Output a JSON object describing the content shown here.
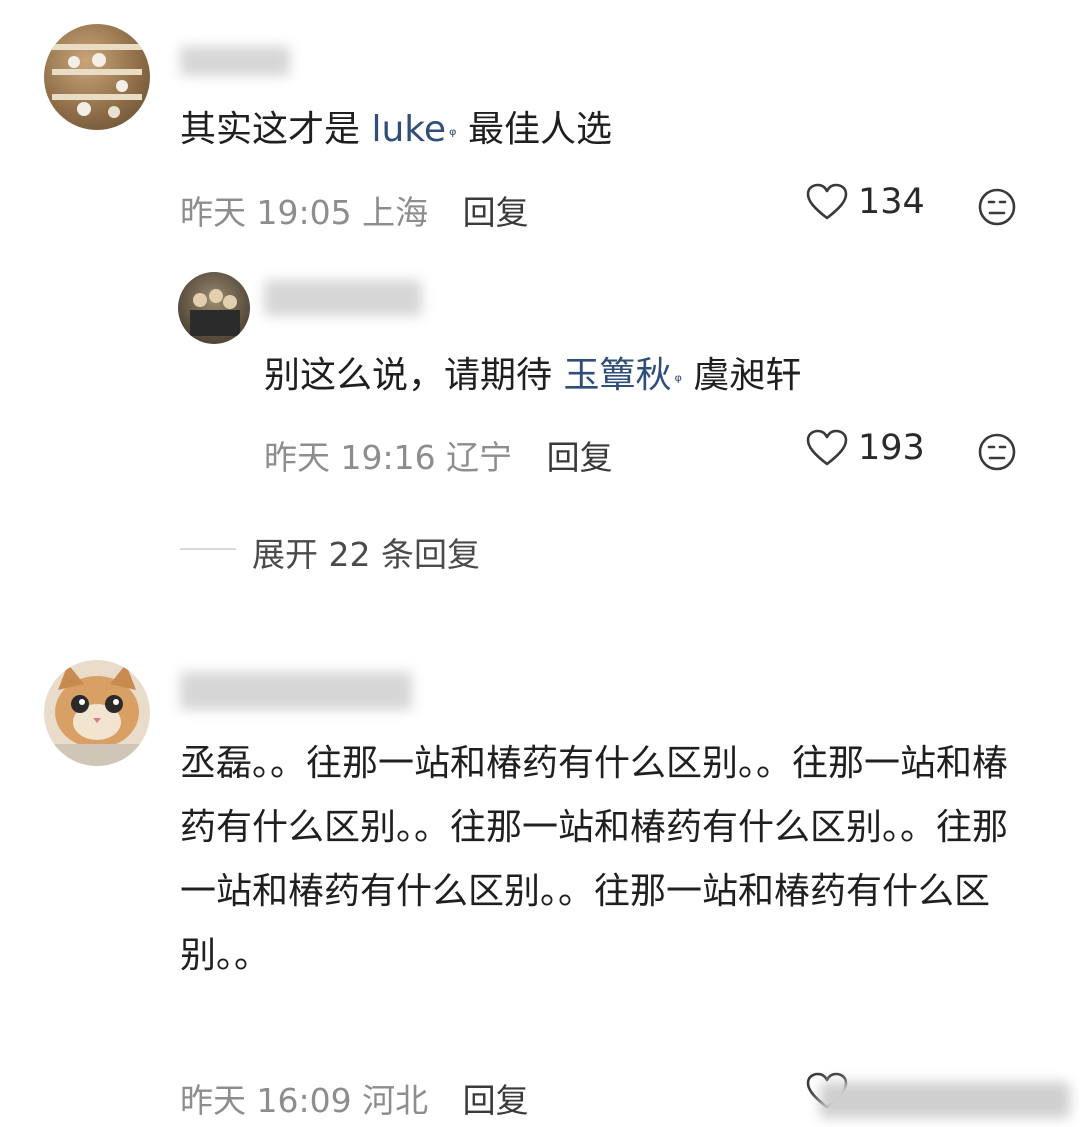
{
  "comments": [
    {
      "text_before": "其实这才是",
      "topic": "luke",
      "text_after": "最佳人选",
      "time": "昨天 19:05",
      "location": "上海",
      "reply_label": "回复",
      "likes": "134"
    },
    {
      "text_before": "别这么说，请期待",
      "topic": "玉簟秋",
      "text_after": "虞昶轩",
      "time": "昨天 19:16",
      "location": "辽宁",
      "reply_label": "回复",
      "likes": "193"
    },
    {
      "text": "丞磊。。往那一站和椿药有什么区别。。往那一站和椿药有什么区别。。往那一站和椿药有什么区别。。往那一站和椿药有什么区别。。往那一站和椿药有什么区别。。",
      "time": "昨天 16:09",
      "location": "河北",
      "reply_label": "回复"
    }
  ],
  "expand": {
    "label": "展开 22 条回复"
  },
  "icons": {
    "heart": "heart-icon",
    "emoji": "neutral-face-icon",
    "topic": "magnifier-icon"
  }
}
